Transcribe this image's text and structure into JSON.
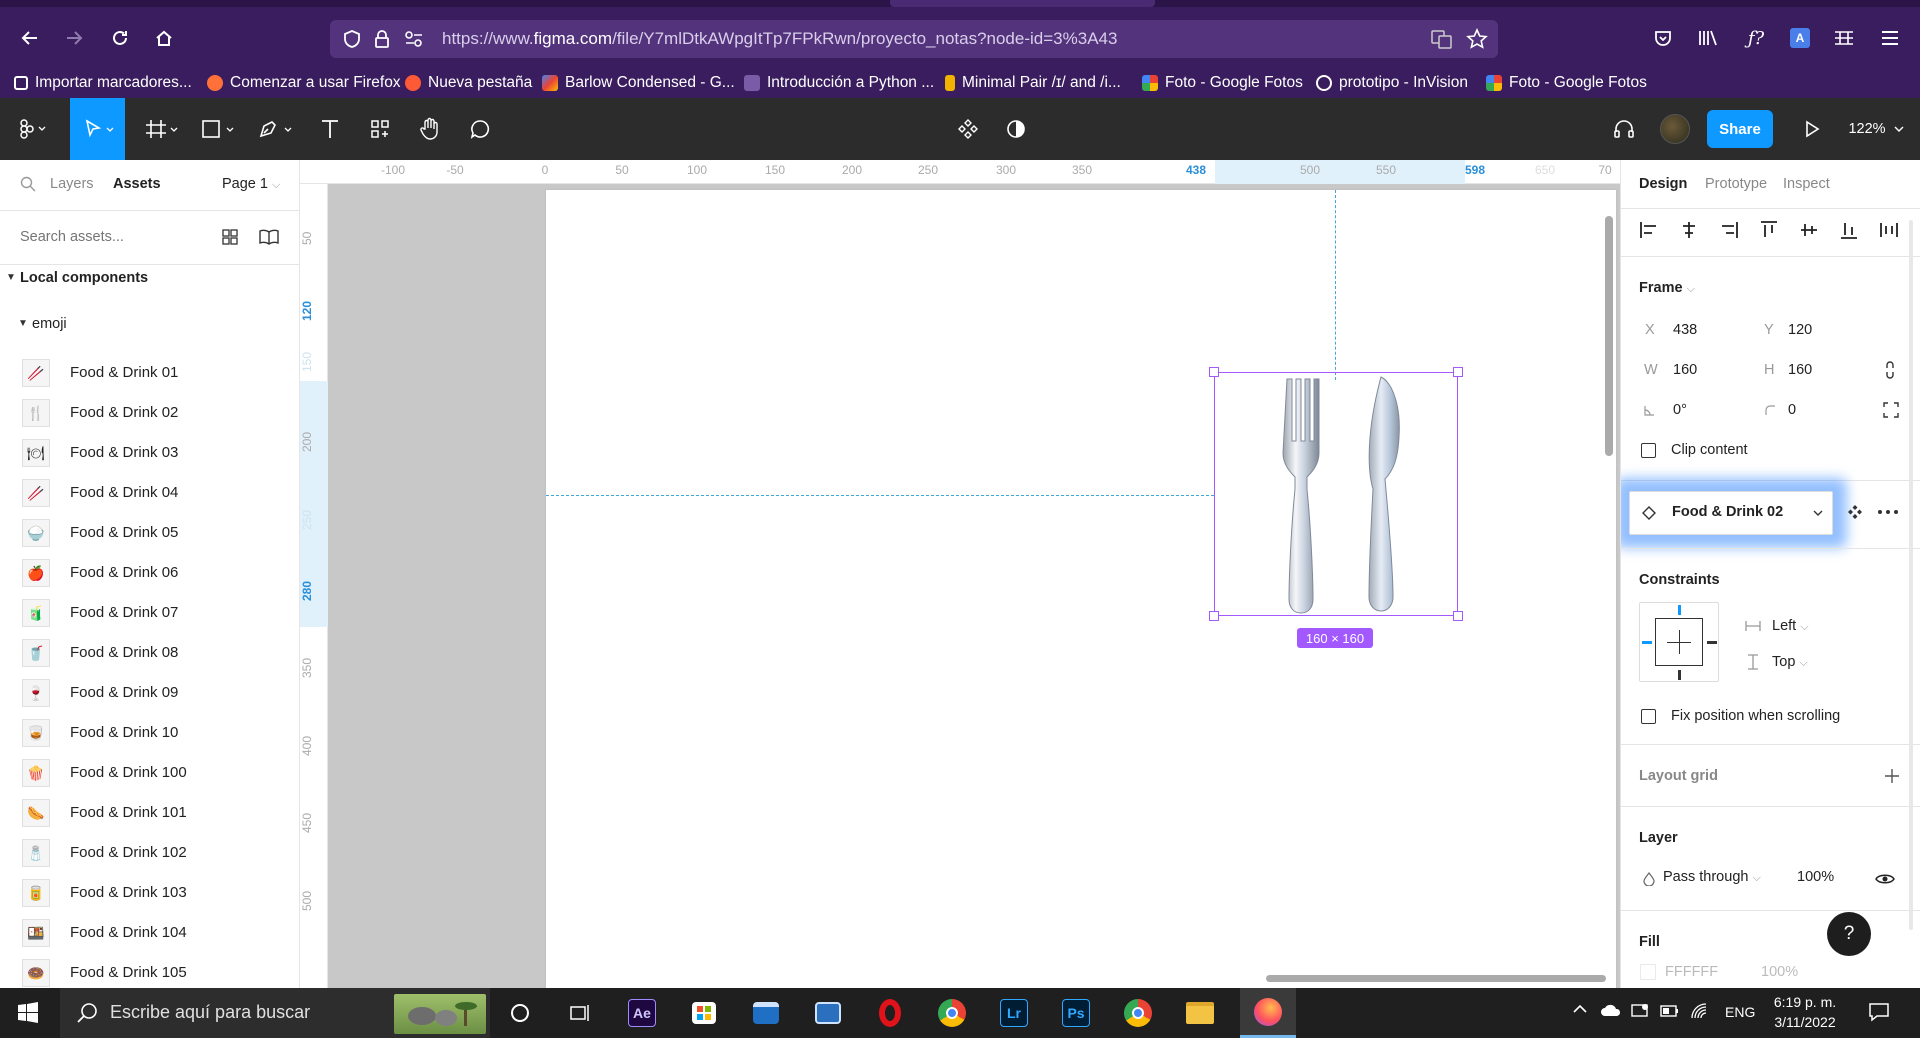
{
  "browser": {
    "url_prefix": "https://www.",
    "url_domain": "figma.com",
    "url_rest": "/file/Y7mlDtkAWpgItTp7FPkRwn/proyecto_notas?node-id=3%3A43",
    "bookmarks": [
      "Importar marcadores...",
      "Comenzar a usar Firefox",
      "Nueva pestaña",
      "Barlow Condensed - G...",
      "Introducción a Python ...",
      "Minimal Pair /ɪ/ and /i...",
      "Foto - Google Fotos",
      "prototipo - InVision",
      "Foto - Google Fotos"
    ]
  },
  "toolbar": {
    "share_label": "Share",
    "zoom": "122%"
  },
  "left_panel": {
    "tab_layers": "Layers",
    "tab_assets": "Assets",
    "page": "Page 1",
    "search_placeholder": "Search assets...",
    "section": "Local components",
    "group": "emoji",
    "items": [
      "Food & Drink 01",
      "Food & Drink 02",
      "Food & Drink 03",
      "Food & Drink 04",
      "Food & Drink 05",
      "Food & Drink 06",
      "Food & Drink 07",
      "Food & Drink 08",
      "Food & Drink 09",
      "Food & Drink 10",
      "Food & Drink 100",
      "Food & Drink 101",
      "Food & Drink 102",
      "Food & Drink 103",
      "Food & Drink 104",
      "Food & Drink 105"
    ],
    "icons": [
      "🥢",
      "🍴",
      "🍽",
      "🥢",
      "🍚",
      "🍎",
      "🧃",
      "🥤",
      "🍷",
      "🥃",
      "🍿",
      "🌭",
      "🧂",
      "🥫",
      "🍱",
      "🍩"
    ]
  },
  "ruler": {
    "top": [
      "-100",
      "-50",
      "0",
      "50",
      "100",
      "150",
      "200",
      "250",
      "300",
      "350",
      "438",
      "500",
      "550",
      "598",
      "650",
      "70"
    ],
    "left": [
      "50",
      "120",
      "150",
      "200",
      "250",
      "280",
      "350",
      "400",
      "450",
      "500"
    ]
  },
  "canvas": {
    "size_badge": "160 × 160"
  },
  "right_panel": {
    "tab_design": "Design",
    "tab_prototype": "Prototype",
    "tab_inspect": "Inspect",
    "frame_label": "Frame",
    "x_label": "X",
    "x": "438",
    "y_label": "Y",
    "y": "120",
    "w_label": "W",
    "w": "160",
    "h_label": "H",
    "h": "160",
    "rotation": "0°",
    "radius": "0",
    "clip_content": "Clip content",
    "component": "Food & Drink 02",
    "constraints": "Constraints",
    "constraint_h": "Left",
    "constraint_v": "Top",
    "fix_position": "Fix position when scrolling",
    "layout_grid": "Layout grid",
    "layer": "Layer",
    "blend": "Pass through",
    "opacity": "100%",
    "fill": "Fill",
    "fill_hex": "FFFFFF",
    "fill_opacity": "100%",
    "help": "?"
  },
  "taskbar": {
    "search_placeholder": "Escribe aquí para buscar",
    "lang": "ENG",
    "time": "6:19 p. m.",
    "date": "3/11/2022"
  },
  "colors": {
    "browser_bg": "#3a1d5e",
    "figma_toolbar": "#2c2c2c",
    "accent": "#0d99ff",
    "selection": "#a259ff"
  }
}
